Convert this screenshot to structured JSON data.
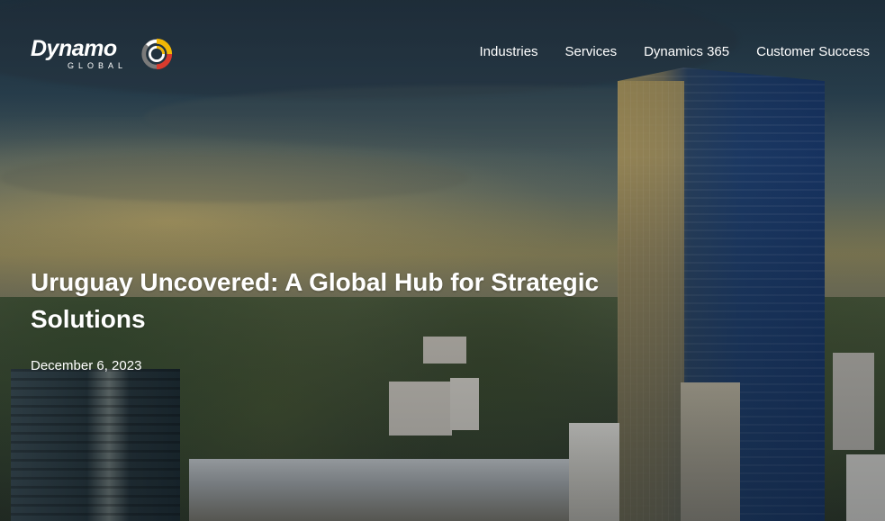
{
  "header": {
    "logo": {
      "wordmark": "Dynamo",
      "subtitle": "GLOBAL",
      "mark_icon": "dynamo-ring-logo-icon",
      "mark_colors": [
        "#f2b705",
        "#d83b2d",
        "#7a7a7a"
      ]
    },
    "nav": [
      {
        "label": "Industries"
      },
      {
        "label": "Services"
      },
      {
        "label": "Dynamics 365"
      },
      {
        "label": "Customer Success"
      }
    ]
  },
  "hero": {
    "title": "Uruguay Uncovered: A Global Hub for Strategic Solutions",
    "date": "December 6, 2023",
    "background_image": "city-skyline-with-glass-tower"
  },
  "colors": {
    "text": "#ffffff"
  }
}
